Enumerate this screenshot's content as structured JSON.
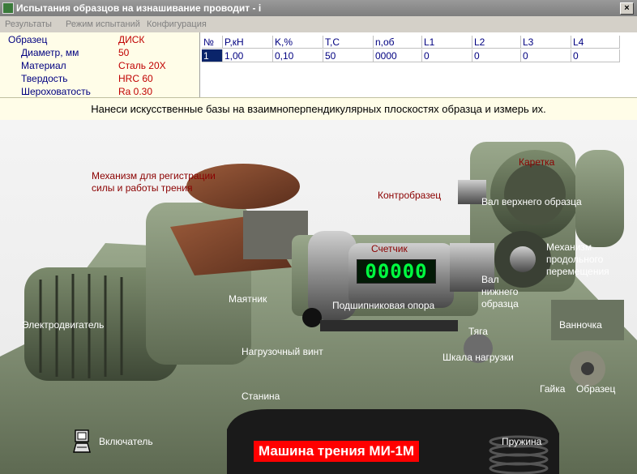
{
  "window": {
    "title": "Испытания образцов на изнашивание проводит - i",
    "close": "×"
  },
  "menu": [
    "Результаты",
    "Режим испытаний",
    "Конфигурация"
  ],
  "sample": {
    "rows": [
      {
        "label": "Образец",
        "value": "ДИСК"
      },
      {
        "label": "Диаметр, мм",
        "value": "50"
      },
      {
        "label": "Материал",
        "value": "Сталь 20Х"
      },
      {
        "label": "Твердость",
        "value": "HRC 60"
      },
      {
        "label": "Шероховатость",
        "value": "Ra 0.30"
      }
    ]
  },
  "table": {
    "headers": [
      "№",
      "P,кН",
      "K,%",
      "T,C",
      "n,об",
      "L1",
      "L2",
      "L3",
      "L4"
    ],
    "rows": [
      [
        "1",
        "1,00",
        "0,10",
        "50",
        "0000",
        "0",
        "0",
        "0",
        "0"
      ]
    ]
  },
  "instruction": "Нанеси искусственные базы на взаимноперпендикулярных плоскостях образца и измерь их.",
  "counter": "00000",
  "labels": {
    "mechanism_reg": "Механизм для регистрации\nсилы и работы трения",
    "karetka": "Каретка",
    "kontrobrazets": "Контробразец",
    "val_upper": "Вал верхнего образца",
    "schetchik": "Счетчик",
    "mech_long": "Механизм\nпродольного\nперемещения",
    "val_lower": "Вал\nнижнего\nобразца",
    "mayatnik": "Маятник",
    "podshipnik": "Подшипниковая опора",
    "elektrodvigatel": "Электродвигатель",
    "tyaga": "Тяга",
    "vannochka": "Ванночка",
    "nagruz_vint": "Нагрузочный винт",
    "shkala": "Шкала нагрузки",
    "gaika": "Гайка",
    "obrazets": "Образец",
    "stanina": "Станина",
    "vklyuchatel": "Включатель",
    "pruzhina": "Пружина"
  },
  "banner": "Машина трения МИ-1М",
  "colors": {
    "title_bg": "#888888",
    "panel_bg": "#fffde8",
    "label_blue": "#000080",
    "value_red": "#c00000",
    "banner_red": "#ff0000",
    "counter_green": "#00ff40"
  }
}
